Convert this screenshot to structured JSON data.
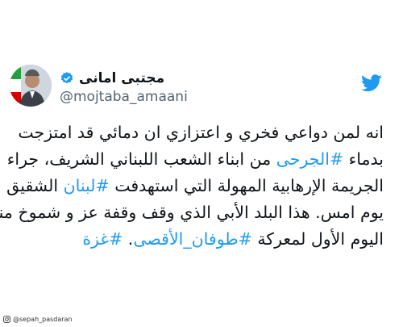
{
  "tweet": {
    "author": {
      "display_name": "مجتبی امانی",
      "handle": "@mojtaba_amaani",
      "verified": true
    },
    "lines": [
      [
        {
          "text": "انه لمن دواعي فخري و اعتزازي ان دمائي قد امتزجت",
          "type": "text"
        }
      ],
      [
        {
          "text": "بدماء ",
          "type": "text"
        },
        {
          "text": "#الجرحى",
          "type": "hashtag"
        },
        {
          "text": " من ابناء الشعب اللبناني الشريف، جراء",
          "type": "text"
        }
      ],
      [
        {
          "text": "الجريمة الإرهابية المهولة التي استهدفت ",
          "type": "text"
        },
        {
          "text": "#لبنان",
          "type": "hashtag"
        },
        {
          "text": " الشقيق",
          "type": "text"
        }
      ],
      [
        {
          "text": "يوم امس. هذا البلد الأبي الذي وقف وقفة عز و شموخ منذ",
          "type": "text"
        }
      ],
      [
        {
          "text": "اليوم الأول لمعركة ",
          "type": "text"
        },
        {
          "text": "#طوفان_الأقصى",
          "type": "hashtag"
        },
        {
          "text": ". ",
          "type": "text"
        },
        {
          "text": "#غزة",
          "type": "hashtag"
        }
      ]
    ]
  },
  "watermark": {
    "text": "@sepah_pasdaran",
    "icon": "instagram-icon"
  },
  "colors": {
    "hashtag": "#1d9bf0",
    "text": "#0f1419",
    "secondary": "#536471",
    "brand": "#1d9bf0"
  },
  "icons": {
    "verified": "verified-badge-icon",
    "brand": "twitter-bird-icon"
  }
}
